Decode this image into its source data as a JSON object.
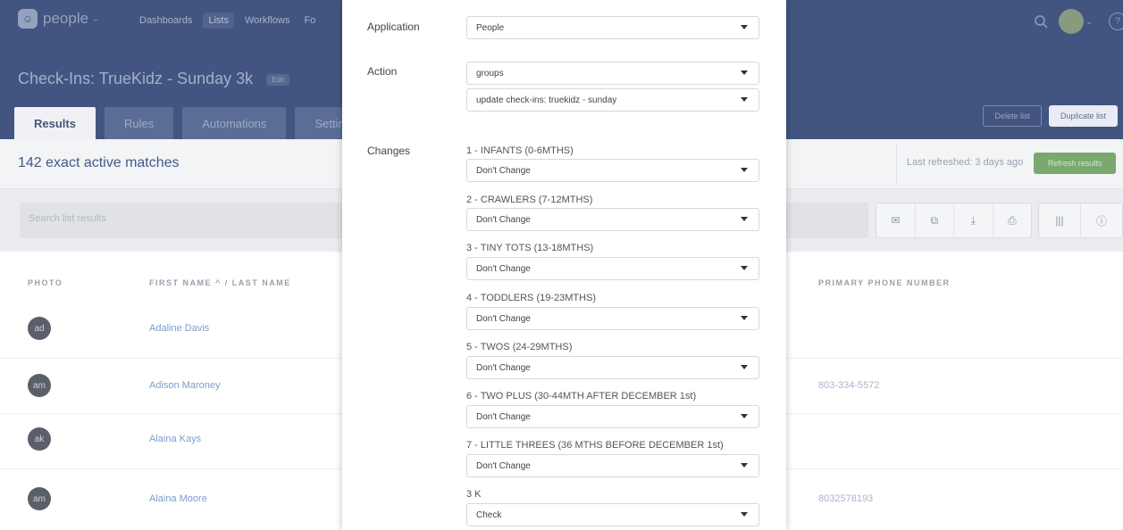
{
  "app": {
    "name": "people",
    "nav": [
      "Dashboards",
      "Lists",
      "Workflows",
      "Fo"
    ],
    "nav_active": 1
  },
  "page": {
    "title": "Check-Ins: TrueKidz - Sunday 3k",
    "edit_label": "Edit",
    "tabs": [
      "Results",
      "Rules",
      "Automations",
      "Settings"
    ],
    "active_tab": 0,
    "delete_label": "Delete list",
    "duplicate_label": "Duplicate list",
    "matches": "142 exact active matches",
    "last_refreshed": "Last refreshed: 3 days ago",
    "refresh_label": "Refresh results",
    "search_placeholder": "Search list results"
  },
  "table": {
    "headers": {
      "photo": "PHOTO",
      "name": "FIRST NAME ^ / LAST NAME",
      "phone": "PRIMARY PHONE NUMBER"
    },
    "rows": [
      {
        "initials": "ad",
        "name": "Adaline Davis",
        "phone": ""
      },
      {
        "initials": "am",
        "name": "Adison Maroney",
        "phone": "803-334-5572"
      },
      {
        "initials": "ak",
        "name": "Alaina Kays",
        "phone": ""
      },
      {
        "initials": "am",
        "name": "Alaina Moore",
        "phone": "8032578193"
      }
    ]
  },
  "modal": {
    "application_label": "Application",
    "application_value": "People",
    "action_label": "Action",
    "action_value": "groups",
    "action_sub_value": "update check-ins: truekidz - sunday",
    "changes_label": "Changes",
    "changes": [
      {
        "label": "1 - INFANTS (0-6MTHS)",
        "value": "Don't Change"
      },
      {
        "label": "2 - CRAWLERS (7-12MTHS)",
        "value": "Don't Change"
      },
      {
        "label": "3 - TINY TOTS (13-18MTHS)",
        "value": "Don't Change"
      },
      {
        "label": "4 - TODDLERS (19-23MTHS)",
        "value": "Don't Change"
      },
      {
        "label": "5 - TWOS (24-29MTHS)",
        "value": "Don't Change"
      },
      {
        "label": "6 - TWO PLUS (30-44MTH AFTER DECEMBER 1st)",
        "value": "Don't Change"
      },
      {
        "label": "7 - LITTLE THREES (36 MTHS BEFORE DECEMBER 1st)",
        "value": "Don't Change"
      },
      {
        "label": "3 K",
        "value": "Check"
      }
    ]
  },
  "colors": {
    "header_bg": "#425581",
    "accent_green": "#7aa86f",
    "link": "#7e9cc9"
  }
}
